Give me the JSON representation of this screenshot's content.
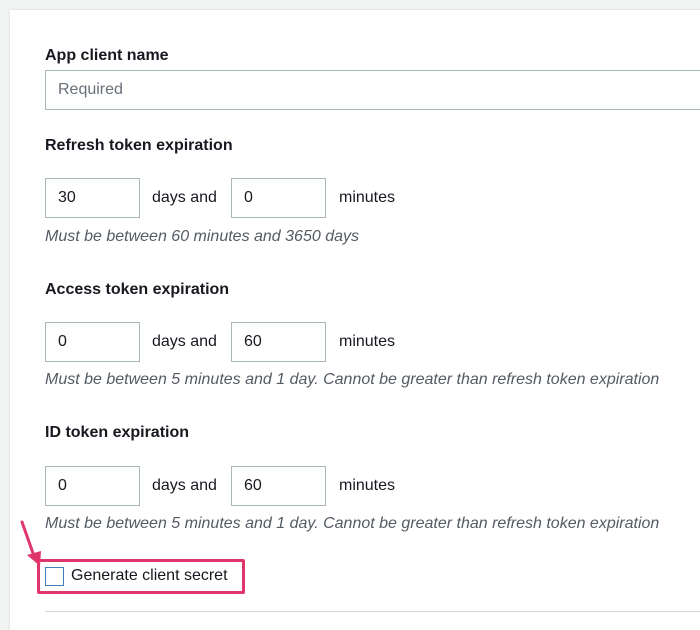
{
  "form": {
    "app_client_name": {
      "label": "App client name",
      "placeholder": "Required",
      "value": ""
    },
    "refresh_token": {
      "label": "Refresh token expiration",
      "days": "30",
      "minutes": "0",
      "hint": "Must be between 60 minutes and 3650 days"
    },
    "access_token": {
      "label": "Access token expiration",
      "days": "0",
      "minutes": "60",
      "hint": "Must be between 5 minutes and 1 day. Cannot be greater than refresh token expiration"
    },
    "id_token": {
      "label": "ID token expiration",
      "days": "0",
      "minutes": "60",
      "hint": "Must be between 5 minutes and 1 day. Cannot be greater than refresh token expiration"
    },
    "days_and_text": "days and",
    "minutes_text": "minutes",
    "generate_secret": {
      "label": "Generate client secret",
      "checked": false
    }
  },
  "colors": {
    "highlight": "#e0356a",
    "checkbox_border": "#3d7fb8"
  }
}
